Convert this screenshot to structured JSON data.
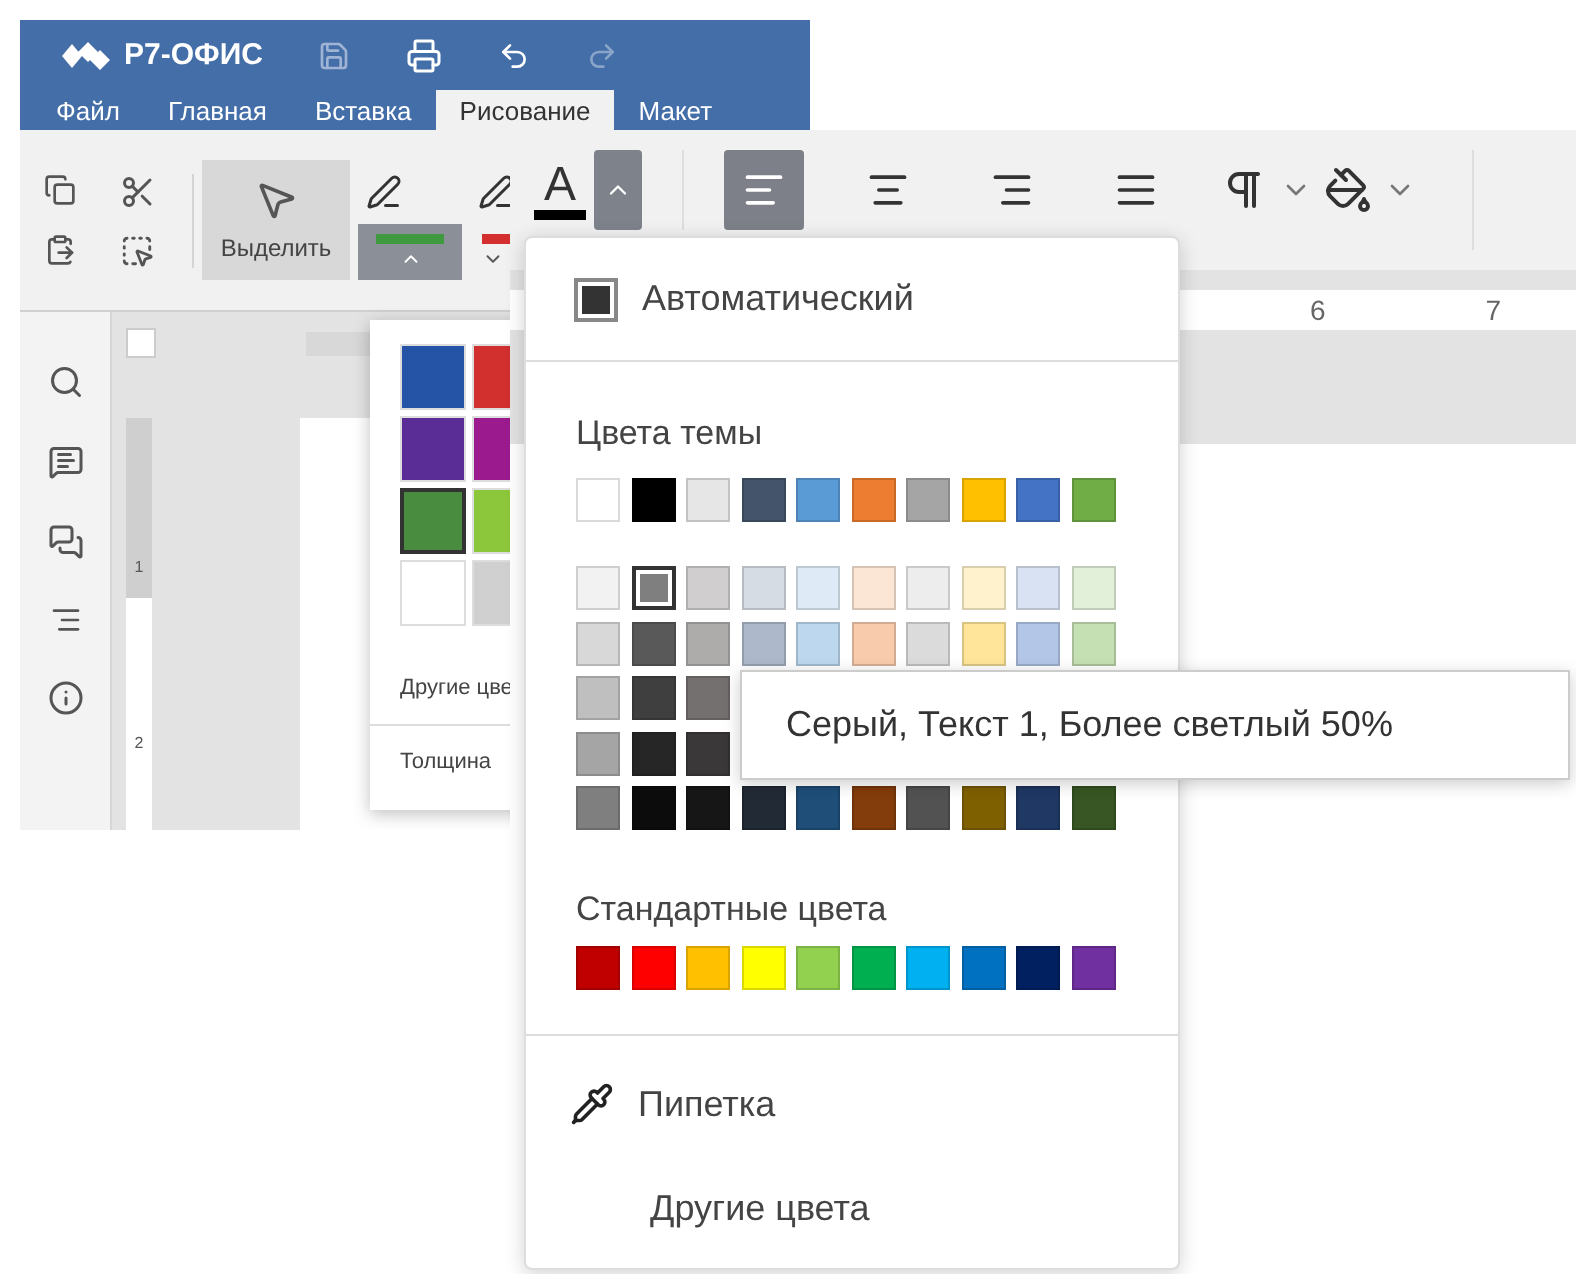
{
  "back_window": {
    "app_name": "Р7-ОФИС",
    "tabs": [
      {
        "label": "Файл",
        "selected": false
      },
      {
        "label": "Главная",
        "selected": false
      },
      {
        "label": "Вставка",
        "selected": false
      },
      {
        "label": "Рисование",
        "selected": true
      },
      {
        "label": "Макет",
        "selected": false
      }
    ],
    "select_button": {
      "label": "Выделить",
      "selected": true
    },
    "pen_tools": [
      {
        "color": "#3f9a3f",
        "expanded": true
      },
      {
        "color": "#d32f2f",
        "expanded": false
      }
    ],
    "vertical_ruler": [
      "1",
      "2"
    ],
    "pen_palette": {
      "swatches": [
        {
          "color": "#2553a6",
          "selected": false
        },
        {
          "color": "#d22f2f",
          "selected": false
        },
        {
          "color": "#5a2d96",
          "selected": false
        },
        {
          "color": "#9b1b8f",
          "selected": false
        },
        {
          "color": "#4a8c3f",
          "selected": true
        },
        {
          "color": "#8cc63a",
          "selected": false
        },
        {
          "color": "#ffffff",
          "selected": false
        },
        {
          "color": "#d0d0d0",
          "selected": false
        }
      ],
      "more_colors": "Другие цве",
      "thickness": "Толщина"
    }
  },
  "front_window": {
    "font_color_button": {
      "letter": "A",
      "color": "#000000",
      "expanded": true
    },
    "align_buttons": [
      {
        "kind": "left",
        "selected": true
      },
      {
        "kind": "center",
        "selected": false
      },
      {
        "kind": "right",
        "selected": false
      },
      {
        "kind": "justify",
        "selected": false
      }
    ],
    "ruler_labels": [
      "6",
      "7"
    ],
    "color_menu": {
      "automatic": "Автоматический",
      "theme_title": "Цвета темы",
      "theme_colors": [
        {
          "color": "#ffffff"
        },
        {
          "color": "#000000"
        },
        {
          "color": "#e7e6e6"
        },
        {
          "color": "#44546a"
        },
        {
          "color": "#5b9bd5"
        },
        {
          "color": "#ed7d31"
        },
        {
          "color": "#a5a5a5"
        },
        {
          "color": "#ffc000"
        },
        {
          "color": "#4472c4"
        },
        {
          "color": "#70ad47"
        }
      ],
      "shades": [
        [
          {
            "color": "#f2f2f2",
            "selected": false
          },
          {
            "color": "#7f7f7f",
            "selected": true
          },
          {
            "color": "#d0cece",
            "selected": false
          },
          {
            "color": "#d6dce4",
            "selected": false
          },
          {
            "color": "#deebf6",
            "selected": false
          },
          {
            "color": "#fbe5d5",
            "selected": false
          },
          {
            "color": "#ededed",
            "selected": false
          },
          {
            "color": "#fff2cc",
            "selected": false
          },
          {
            "color": "#d9e2f3",
            "selected": false
          },
          {
            "color": "#e2efd9",
            "selected": false
          }
        ],
        [
          {
            "color": "#d8d8d8",
            "selected": false
          },
          {
            "color": "#595959",
            "selected": false
          },
          {
            "color": "#aeabab",
            "selected": false
          },
          {
            "color": "#adb9ca",
            "selected": false
          },
          {
            "color": "#bdd7ee",
            "selected": false
          },
          {
            "color": "#f7cbac",
            "selected": false
          },
          {
            "color": "#dbdbdb",
            "selected": false
          },
          {
            "color": "#fee599",
            "selected": false
          },
          {
            "color": "#b4c6e7",
            "selected": false
          },
          {
            "color": "#c5e0b3",
            "selected": false
          }
        ],
        [
          {
            "color": "#bfbfbf",
            "selected": false
          },
          {
            "color": "#3f3f3f",
            "selected": false
          },
          {
            "color": "#757070",
            "selected": false
          }
        ],
        [
          {
            "color": "#a5a5a5",
            "selected": false
          },
          {
            "color": "#262626",
            "selected": false
          },
          {
            "color": "#3a3838",
            "selected": false
          }
        ],
        [
          {
            "color": "#7f7f7f",
            "selected": false
          },
          {
            "color": "#0c0c0c",
            "selected": false
          },
          {
            "color": "#171616",
            "selected": false
          },
          {
            "color": "#222a35",
            "selected": false
          },
          {
            "color": "#1f4e79",
            "selected": false
          },
          {
            "color": "#833c0b",
            "selected": false
          },
          {
            "color": "#525252",
            "selected": false
          },
          {
            "color": "#7f6000",
            "selected": false
          },
          {
            "color": "#1f3864",
            "selected": false
          },
          {
            "color": "#375623",
            "selected": false
          }
        ]
      ],
      "standard_title": "Стандартные цвета",
      "standard_colors": [
        {
          "color": "#c00000"
        },
        {
          "color": "#ff0000"
        },
        {
          "color": "#ffc000"
        },
        {
          "color": "#ffff00"
        },
        {
          "color": "#92d050"
        },
        {
          "color": "#00b050"
        },
        {
          "color": "#00b0f0"
        },
        {
          "color": "#0070c0"
        },
        {
          "color": "#002060"
        },
        {
          "color": "#7030a0"
        }
      ],
      "eyedropper": "Пипетка",
      "more_colors": "Другие цвета",
      "tooltip": "Серый, Текст 1, Более светлый 50%"
    }
  }
}
